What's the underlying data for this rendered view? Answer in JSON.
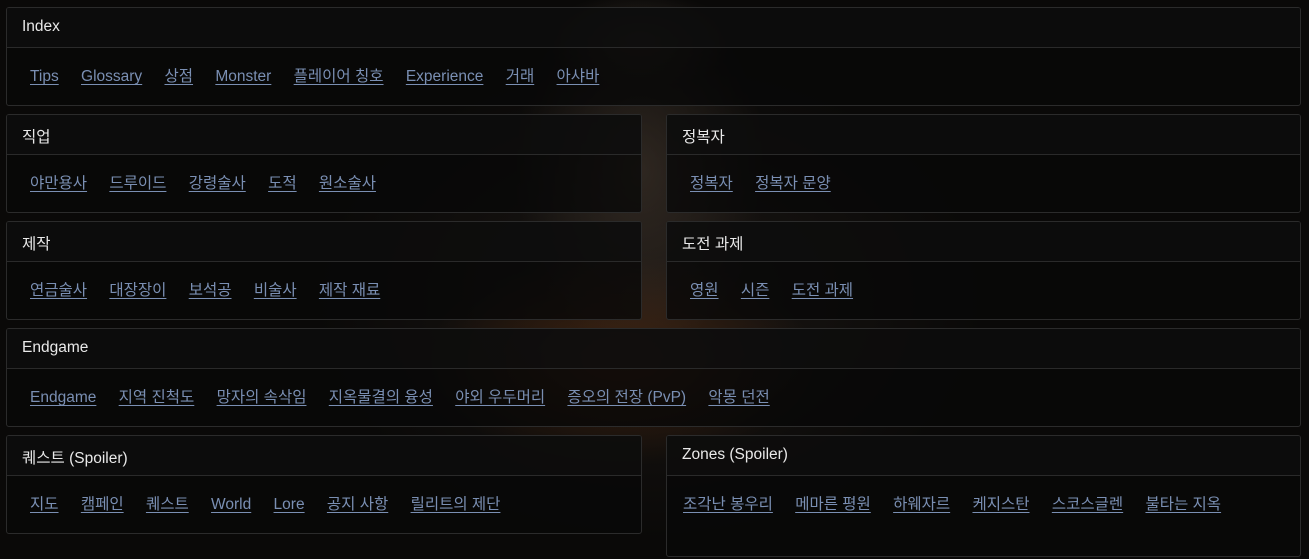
{
  "sections": {
    "index": {
      "title": "Index",
      "links": [
        "Tips",
        "Glossary",
        "상점",
        "Monster",
        "플레이어 칭호",
        "Experience",
        "거래",
        "아샤바"
      ]
    },
    "classes": {
      "title": "직업",
      "links": [
        "야만용사",
        "드루이드",
        "강령술사",
        "도적",
        "원소술사"
      ]
    },
    "conqueror": {
      "title": "정복자",
      "links": [
        "정복자",
        "정복자 문양"
      ]
    },
    "crafting": {
      "title": "제작",
      "links": [
        "연금술사",
        "대장장이",
        "보석공",
        "비술사",
        "제작 재료"
      ]
    },
    "challenges": {
      "title": "도전 과제",
      "links": [
        "영원",
        "시즌",
        "도전 과제"
      ]
    },
    "endgame": {
      "title": "Endgame",
      "links": [
        "Endgame",
        "지역 진척도",
        "망자의 속삭임",
        "지옥물결의 융성",
        "야외 우두머리",
        "증오의 전장 (PvP)",
        "악몽 던전"
      ]
    },
    "quests": {
      "title": "퀘스트 (Spoiler)",
      "links": [
        "지도",
        "캠페인",
        "퀘스트",
        "World",
        "Lore",
        "공지 사항",
        "릴리트의 제단"
      ]
    },
    "zones": {
      "title": "Zones (Spoiler)",
      "links": [
        "조각난 봉우리",
        "메마른 평원",
        "하웨자르",
        "케지스탄",
        "스코스글렌",
        "불타는 지옥"
      ]
    }
  }
}
